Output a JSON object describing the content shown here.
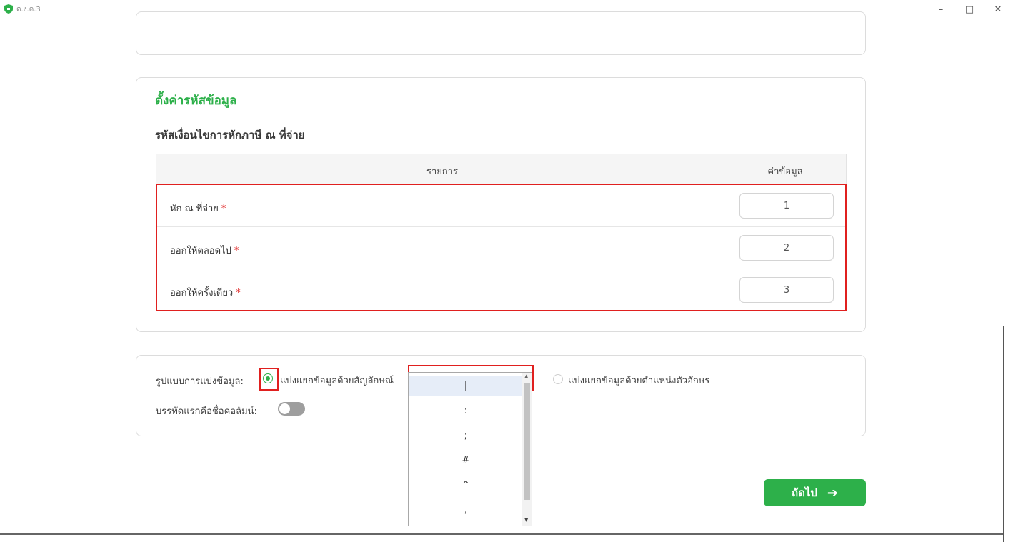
{
  "window": {
    "title": "ต.ง.ด.3",
    "minimize": "–",
    "maximize": "□",
    "close": "✕"
  },
  "settings": {
    "section_title": "ตั้งค่ารหัสข้อมูล",
    "subtitle": "รหัสเงื่อนไขการหักภาษี ณ ที่จ่าย",
    "table": {
      "headers": [
        "รายการ",
        "ค่าข้อมูล"
      ],
      "rows": [
        {
          "label": "หัก ณ ที่จ่าย",
          "required": "*",
          "value": "1"
        },
        {
          "label": "ออกให้ตลอดไป",
          "required": "*",
          "value": "2"
        },
        {
          "label": "ออกให้ครั้งเดียว",
          "required": "*",
          "value": "3"
        }
      ]
    }
  },
  "format": {
    "label": "รูปแบบการแบ่งข้อมูล:",
    "option_symbol": "แบ่งแยกข้อมูลด้วยสัญลักษณ์",
    "option_position": "แบ่งแยกข้อมูลด้วยตำแหน่งตัวอักษร",
    "selected_option": "symbol",
    "delimiter_value": "|",
    "delimiter_options": [
      "|",
      ":",
      ";",
      "#",
      "^",
      ","
    ],
    "header_row_label": "บรรทัดแรกคือชื่อคอลัมน์:",
    "header_row_enabled": false
  },
  "actions": {
    "next_label": "ถัดไป",
    "next_icon": "arrow-right-icon"
  },
  "colors": {
    "accent": "#2db04a",
    "highlight": "#e0201f"
  }
}
